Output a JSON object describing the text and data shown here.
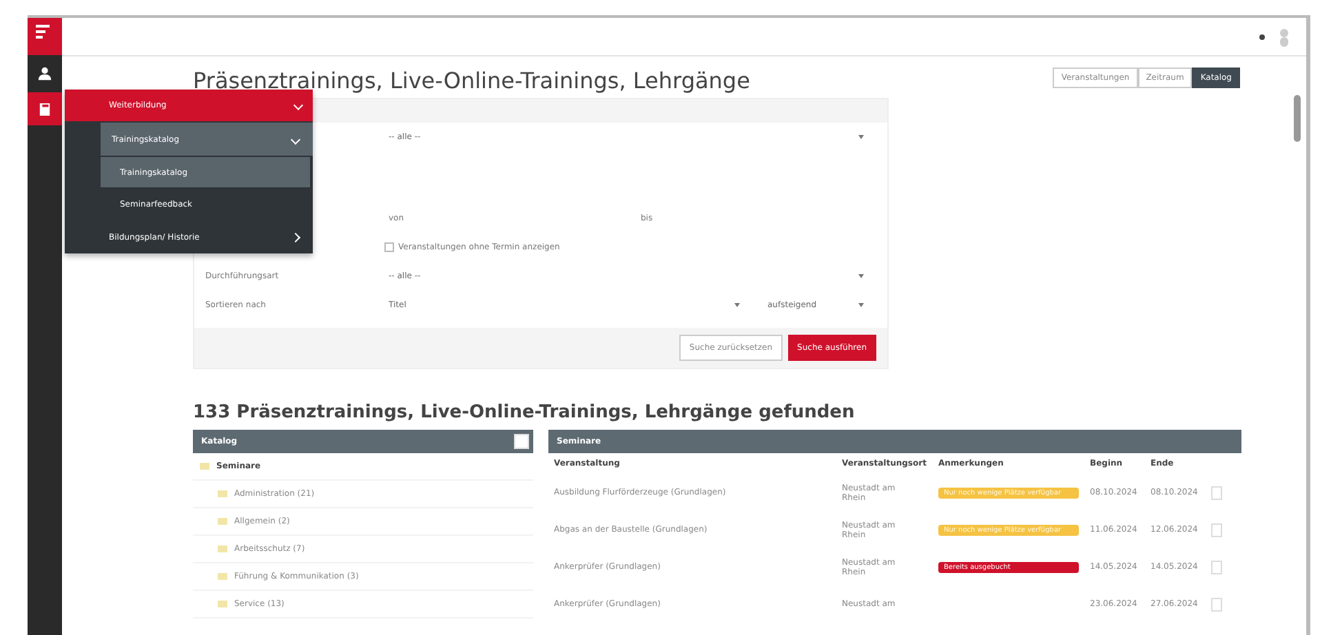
{
  "menu": {
    "title": "Weiterbildung",
    "expanded": true,
    "items": [
      {
        "label": "Trainingskatalog",
        "expanded": true,
        "children": [
          {
            "label": "Trainingskatalog",
            "selected": true
          },
          {
            "label": "Seminarfeedback",
            "selected": false
          }
        ]
      },
      {
        "label": "Bildungsplan/ Historie",
        "expanded": false
      }
    ]
  },
  "page_title": "Präsenztrainings, Live-Online-Trainings, Lehrgänge",
  "view_tabs": [
    {
      "label": "Veranstaltungen",
      "selected": false
    },
    {
      "label": "Zeitraum",
      "selected": false
    },
    {
      "label": "Katalog",
      "selected": true
    }
  ],
  "filter": {
    "category_select": "-- alle --",
    "from_placeholder": "von",
    "to_label": "bis",
    "no_date_checkbox": {
      "label": "Veranstaltungen ohne Termin anzeigen",
      "checked": false
    },
    "type_label": "Durchführungsart",
    "type_select": "-- alle --",
    "sort_label": "Sortieren nach",
    "sort_select": "Titel",
    "order_select": "aufsteigend",
    "buttons": [
      {
        "label": "Suche zurücksetzen",
        "kind": "secondary"
      },
      {
        "label": "Suche ausführen",
        "kind": "primary"
      }
    ]
  },
  "result_heading": "133 Präsenztrainings, Live-Online-Trainings, Lehrgänge gefunden",
  "catalog": {
    "title": "Katalog",
    "tree": [
      {
        "label": "Seminare",
        "children": [
          {
            "label": "Administration (21)"
          },
          {
            "label": "Allgemein (2)"
          },
          {
            "label": "Arbeitsschutz (7)"
          },
          {
            "label": "Führung & Kommunikation (3)"
          },
          {
            "label": "Service (13)"
          }
        ]
      }
    ]
  },
  "seminars": {
    "title": "Seminare",
    "columns": [
      "Veranstaltung",
      "Veranstaltungsort",
      "Anmerkungen",
      "Beginn",
      "Ende"
    ],
    "rows": [
      {
        "title": "Ausbildung Flurförderzeuge (Grundlagen)",
        "location": "Neustadt am Rhein",
        "note": {
          "text": "Nur noch wenige Plätze verfügbar",
          "color": "#f5c242"
        },
        "start": "08.10.2024",
        "end": "08.10.2024"
      },
      {
        "title": "Abgas an der Baustelle (Grundlagen)",
        "location": "Neustadt am Rhein",
        "note": {
          "text": "Nur noch wenige Plätze verfügbar",
          "color": "#f5c242"
        },
        "start": "11.06.2024",
        "end": "12.06.2024"
      },
      {
        "title": "Ankerprüfer (Grundlagen)",
        "location": "Neustadt am Rhein",
        "note": {
          "text": "Bereits ausgebucht",
          "color": "#d0112b"
        },
        "start": "14.05.2024",
        "end": "14.05.2024"
      },
      {
        "title": "Ankerprüfer (Grundlagen)",
        "location": "Neustadt am",
        "start": "23.06.2024",
        "end": "27.06.2024"
      }
    ]
  }
}
